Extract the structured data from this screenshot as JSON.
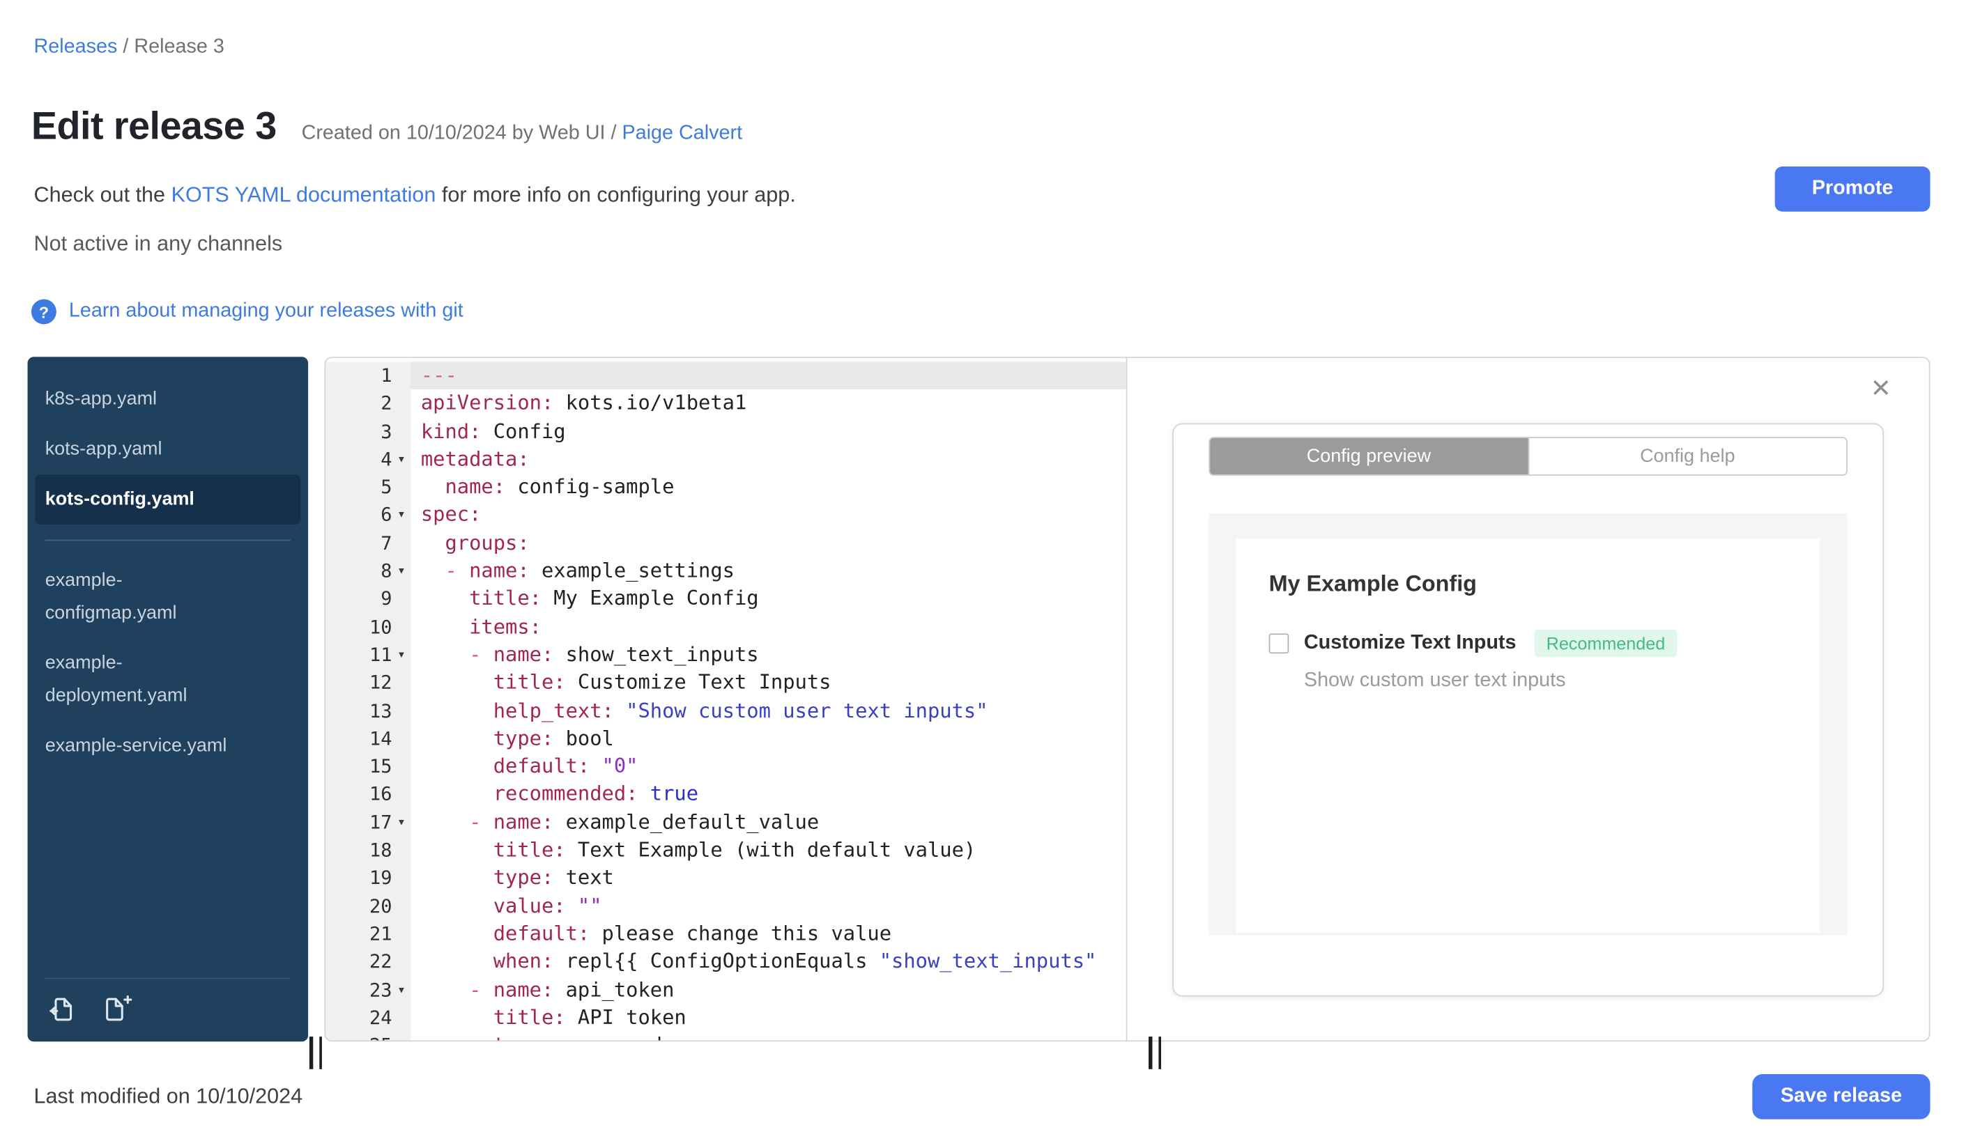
{
  "colors": {
    "accent_button": "#4a78f3",
    "link": "#3e7be0",
    "sidebar_bg": "#20415e",
    "sidebar_selected_bg": "#15304b",
    "badge_bg": "#e1f7ec",
    "badge_text": "#43ba8a"
  },
  "breadcrumb": {
    "link": "Releases",
    "separator": "/",
    "current": "Release 3"
  },
  "header": {
    "title": "Edit release 3",
    "created_prefix": "Created on 10/10/2024 by Web UI /",
    "created_link": "Paige Calvert",
    "doc_prefix": "Check out the",
    "doc_link": "KOTS YAML documentation",
    "doc_suffix": "for more info on configuring your app.",
    "channel_status": "Not active in any channels",
    "promote_button": "Promote",
    "help_icon": "?",
    "git_help_link": "Learn about managing your releases with git"
  },
  "file_tree": {
    "groups": [
      {
        "files": [
          {
            "name": "k8s-app.yaml",
            "selected": false
          },
          {
            "name": "kots-app.yaml",
            "selected": false
          },
          {
            "name": "kots-config.yaml",
            "selected": true
          }
        ]
      },
      {
        "files": [
          {
            "name": "example-configmap.yaml",
            "selected": false
          },
          {
            "name": "example-deployment.yaml",
            "selected": false
          },
          {
            "name": "example-service.yaml",
            "selected": false
          }
        ]
      }
    ],
    "actions": [
      "upload-file",
      "new-file"
    ]
  },
  "editor": {
    "active_line": 1,
    "fold_lines": [
      4,
      6,
      8,
      11,
      17,
      23
    ],
    "fold_glyph": "▾",
    "lines": [
      [
        [
          "doc",
          "---"
        ]
      ],
      [
        [
          "key",
          "apiVersion:"
        ],
        [
          "pln",
          " kots.io/v1beta1"
        ]
      ],
      [
        [
          "key",
          "kind:"
        ],
        [
          "pln",
          " Config"
        ]
      ],
      [
        [
          "key",
          "metadata:"
        ]
      ],
      [
        [
          "pln",
          "  "
        ],
        [
          "key",
          "name:"
        ],
        [
          "pln",
          " config-sample"
        ]
      ],
      [
        [
          "key",
          "spec:"
        ]
      ],
      [
        [
          "pln",
          "  "
        ],
        [
          "key",
          "groups:"
        ]
      ],
      [
        [
          "pln",
          "  "
        ],
        [
          "dash",
          "- "
        ],
        [
          "key",
          "name:"
        ],
        [
          "pln",
          " example_settings"
        ]
      ],
      [
        [
          "pln",
          "    "
        ],
        [
          "key",
          "title:"
        ],
        [
          "pln",
          " My Example Config"
        ]
      ],
      [
        [
          "pln",
          "    "
        ],
        [
          "key",
          "items:"
        ]
      ],
      [
        [
          "pln",
          "    "
        ],
        [
          "dash",
          "- "
        ],
        [
          "key",
          "name:"
        ],
        [
          "pln",
          " show_text_inputs"
        ]
      ],
      [
        [
          "pln",
          "      "
        ],
        [
          "key",
          "title:"
        ],
        [
          "pln",
          " Customize Text Inputs"
        ]
      ],
      [
        [
          "pln",
          "      "
        ],
        [
          "key",
          "help_text:"
        ],
        [
          "pln",
          " "
        ],
        [
          "str",
          "\"Show custom user text inputs\""
        ]
      ],
      [
        [
          "pln",
          "      "
        ],
        [
          "key",
          "type:"
        ],
        [
          "pln",
          " bool"
        ]
      ],
      [
        [
          "pln",
          "      "
        ],
        [
          "key",
          "default:"
        ],
        [
          "pln",
          " "
        ],
        [
          "qstr",
          "\"0\""
        ]
      ],
      [
        [
          "pln",
          "      "
        ],
        [
          "key",
          "recommended:"
        ],
        [
          "pln",
          " "
        ],
        [
          "bool",
          "true"
        ]
      ],
      [
        [
          "pln",
          "    "
        ],
        [
          "dash",
          "- "
        ],
        [
          "key",
          "name:"
        ],
        [
          "pln",
          " example_default_value"
        ]
      ],
      [
        [
          "pln",
          "      "
        ],
        [
          "key",
          "title:"
        ],
        [
          "pln",
          " Text Example (with default value)"
        ]
      ],
      [
        [
          "pln",
          "      "
        ],
        [
          "key",
          "type:"
        ],
        [
          "pln",
          " text"
        ]
      ],
      [
        [
          "pln",
          "      "
        ],
        [
          "key",
          "value:"
        ],
        [
          "pln",
          " "
        ],
        [
          "qstr",
          "\"\""
        ]
      ],
      [
        [
          "pln",
          "      "
        ],
        [
          "key",
          "default:"
        ],
        [
          "pln",
          " please change this value"
        ]
      ],
      [
        [
          "pln",
          "      "
        ],
        [
          "key",
          "when:"
        ],
        [
          "pln",
          " repl{{ ConfigOptionEquals "
        ],
        [
          "str",
          "\"show_text_inputs\""
        ]
      ],
      [
        [
          "pln",
          "    "
        ],
        [
          "dash",
          "- "
        ],
        [
          "key",
          "name:"
        ],
        [
          "pln",
          " api_token"
        ]
      ],
      [
        [
          "pln",
          "      "
        ],
        [
          "key",
          "title:"
        ],
        [
          "pln",
          " API token"
        ]
      ],
      [
        [
          "pln",
          "      "
        ],
        [
          "key",
          "type:"
        ],
        [
          "pln",
          " password"
        ]
      ]
    ]
  },
  "preview": {
    "close_icon": "✕",
    "tabs": [
      {
        "label": "Config preview",
        "active": true
      },
      {
        "label": "Config help",
        "active": false
      }
    ],
    "group_title": "My Example Config",
    "item": {
      "label": "Customize Text Inputs",
      "badge": "Recommended",
      "help_text": "Show custom user text inputs",
      "checked": false
    }
  },
  "footer": {
    "last_modified": "Last modified on 10/10/2024",
    "save_button": "Save release"
  }
}
